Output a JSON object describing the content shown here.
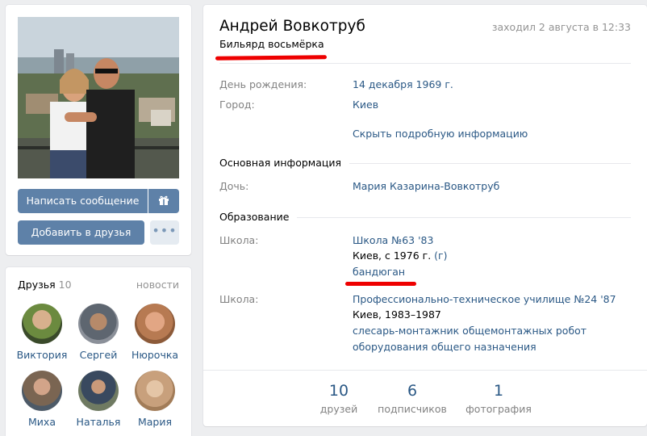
{
  "left": {
    "message_button": "Написать сообщение",
    "gift_icon": "gift-icon",
    "add_friend_button": "Добавить в друзья",
    "more_button": "•••",
    "friends": {
      "title": "Друзья",
      "count": "10",
      "news_link": "новости",
      "items": [
        {
          "name": "Виктория"
        },
        {
          "name": "Сергей"
        },
        {
          "name": "Нюрочка"
        },
        {
          "name": "Миха"
        },
        {
          "name": "Наталья"
        },
        {
          "name": "Мария"
        }
      ]
    }
  },
  "profile": {
    "name": "Андрей Вовкотруб",
    "last_seen": "заходил 2 августа в 12:33",
    "status": "Бильярд восьмёрка",
    "birthday_label": "День рождения:",
    "birthday_value": "14 декабря 1969 г.",
    "city_label": "Город:",
    "city_value": "Киев",
    "hide_details_link": "Скрыть подробную информацию",
    "main_info_title": "Основная информация",
    "daughter_label": "Дочь:",
    "daughter_value": "Мария Казарина-Вовкотруб",
    "education_title": "Образование",
    "school1": {
      "label": "Школа:",
      "name": "Школа №63 '83",
      "detail": "Киев, с 1976 г.",
      "class_tag": "(г)",
      "specialty": "бандюган"
    },
    "school2": {
      "label": "Школа:",
      "name": "Профессионально-техническое училище №24 '87",
      "detail": "Киев, 1983–1987",
      "specialty_line1": "слесарь-монтажник общемонтажных робот",
      "specialty_line2": "оборудования общего назначения"
    }
  },
  "counters": [
    {
      "num": "10",
      "label": "друзей"
    },
    {
      "num": "6",
      "label": "подписчиков"
    },
    {
      "num": "1",
      "label": "фотография"
    }
  ],
  "colors": {
    "link": "#2a5885",
    "button": "#5e81a8",
    "annotation": "#ee0000"
  }
}
